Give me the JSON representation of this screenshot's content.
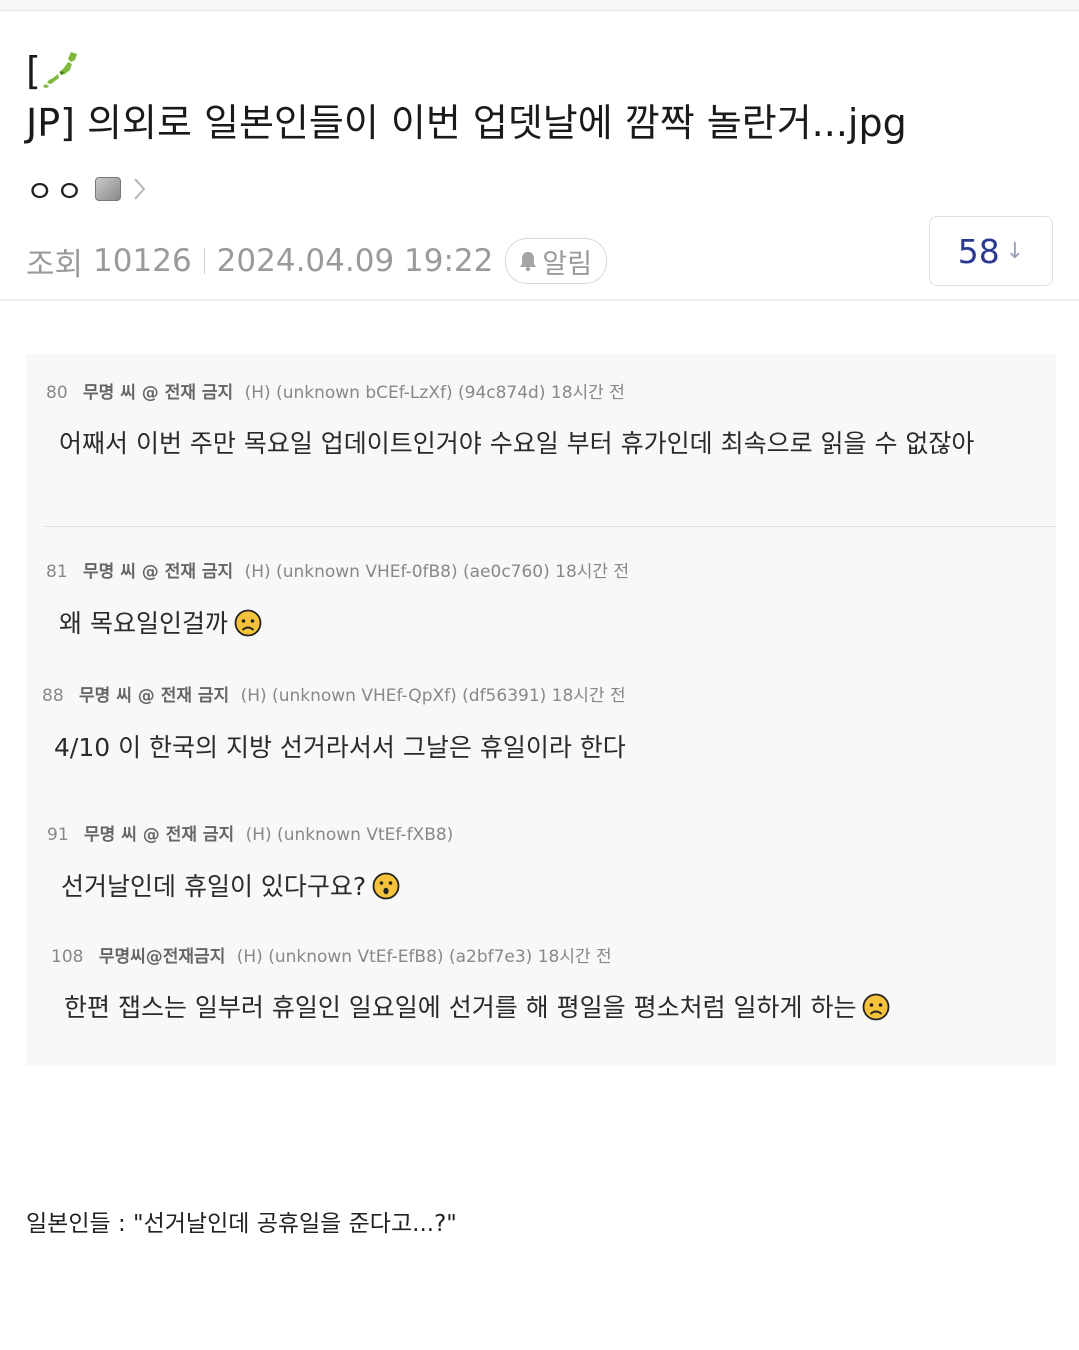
{
  "post": {
    "title_prefix": "[",
    "title_flag_icon": "japan-map-icon",
    "title_text": "JP] 의외로 일본인들이 이번 업뎃날에 깜짝 놀란거...jpg",
    "author": "ㅇㅇ",
    "views_label": "조회",
    "views": "10126",
    "datetime": "2024.04.09 19:22",
    "alarm_label": "알림",
    "recommend_count": "58",
    "recommend_arrow": "↓"
  },
  "comments": [
    {
      "num": "80",
      "nick": "무명 씨 @ 전재 금지",
      "info": "(H) (unknown bCEf-LzXf) (94c874d) 18시간 전",
      "text": "어째서 이번 주만 목요일 업데이트인거야 수요일 부터 휴가인데 최속으로 읽을 수 없잖아",
      "emoji": ""
    },
    {
      "num": "81",
      "nick": "무명 씨 @ 전재 금지",
      "info": "(H) (unknown VHEf-0fB8) (ae0c760) 18시간 전",
      "text": "왜 목요일인걸까",
      "emoji": "sad-face-icon"
    },
    {
      "num": "88",
      "nick": "무명 씨 @ 전재 금지",
      "info": "(H) (unknown VHEf-QpXf) (df56391) 18시간 전",
      "text": "4/10 이 한국의 지방 선거라서서 그날은 휴일이라 한다",
      "emoji": ""
    },
    {
      "num": "91",
      "nick": "무명 씨 @ 전재 금지",
      "info": "(H) (unknown VtEf-fXB8)",
      "text": "선거날인데 휴일이 있다구요?",
      "emoji": "surprised-face-icon"
    },
    {
      "num": "108",
      "nick": "무명씨@전재금지",
      "info": "(H) (unknown VtEf-EfB8) (a2bf7e3) 18시간 전",
      "text": "한편 잽스는 일부러 휴일인 일요일에 선거를 해 평일을 평소처럼 일하게 하는",
      "emoji": "sad-face-icon"
    }
  ],
  "body_text": "일본인들 :  \"선거날인데 공휴일을 준다고...?\"",
  "colors": {
    "recommend": "#2b3a8f",
    "meta_gray": "#9a9a9a",
    "quote_bg": "#f8f8f9"
  }
}
